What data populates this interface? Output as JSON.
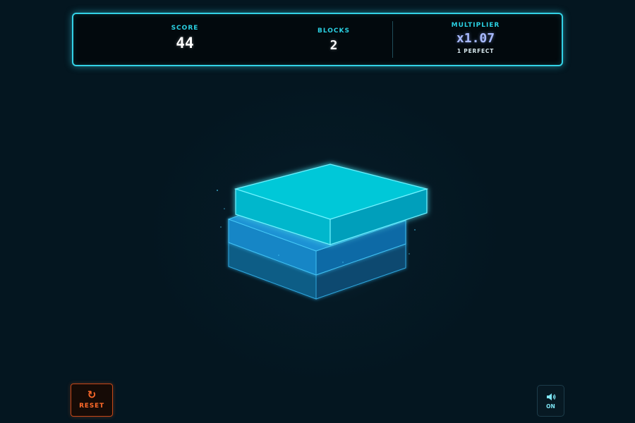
{
  "hud": {
    "score_label": "SCORE",
    "score_value": "44",
    "blocks_label": "BLOCKS",
    "blocks_value": "2",
    "multiplier_label": "MULTIPLIER",
    "multiplier_value": "x1.07",
    "perfect_text": "1 PERFECT"
  },
  "tower": {
    "placed_blocks": 2,
    "moving_block": true,
    "colors": {
      "base_block": "#0b5f8f",
      "stacked_block": "#0d86c6",
      "moving_block": "#00c9d9",
      "glow": "#39d9ff"
    }
  },
  "controls": {
    "reset_icon": "refresh-icon",
    "reset_label": "RESET",
    "sound_icon": "speaker-icon",
    "sound_label": "ON"
  },
  "colors": {
    "accent": "#33d2e6",
    "multiplier": "#a7b9ff",
    "reset": "#ff6a2a",
    "background": "#041620"
  }
}
